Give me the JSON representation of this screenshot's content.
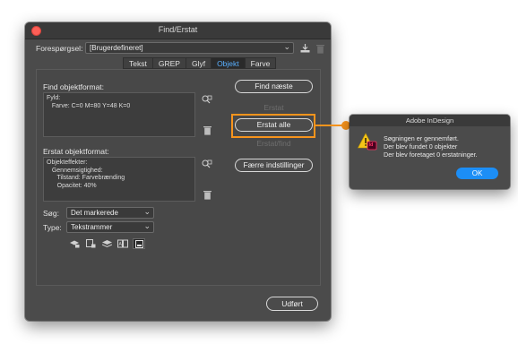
{
  "dialog": {
    "title": "Find/Erstat",
    "query_label": "Forespørgsel:",
    "query_value": "[Brugerdefineret]",
    "tabs": [
      {
        "label": "Tekst"
      },
      {
        "label": "GREP"
      },
      {
        "label": "Glyf"
      },
      {
        "label": "Objekt",
        "active": true
      },
      {
        "label": "Farve"
      }
    ],
    "find_section": {
      "title": "Find objektformat:",
      "lines": [
        "Fyld:",
        "   Farve: C=0 M=80 Y=48 K=0"
      ]
    },
    "replace_section": {
      "title": "Erstat objektformat:",
      "lines": [
        "Objekteffekter:",
        "   Gennemsigtighed:",
        "      Tilstand: Farvebrænding",
        "      Opacitet: 40%"
      ]
    },
    "search_label": "Søg:",
    "search_value": "Det markerede",
    "type_label": "Type:",
    "type_value": "Tekstrammer",
    "buttons": {
      "find_next": "Find næste",
      "replace": "Erstat",
      "replace_all": "Erstat alle",
      "replace_find": "Erstat/find",
      "fewer_options": "Færre indstillinger",
      "done": "Udført"
    },
    "icons": [
      "save-query-icon",
      "trash-icon",
      "specify-format-icon",
      "clear-format-icon",
      "locked-layers-icon",
      "locked-items-icon",
      "hidden-layers-icon",
      "master-pages-icon",
      "footnotes-icon"
    ]
  },
  "alert": {
    "title": "Adobe InDesign",
    "lines": [
      "Søgningen er gennemført.",
      "Der blev fundet 0 objekter",
      "Der blev foretaget 0 erstatninger."
    ],
    "ok_label": "OK",
    "app_badge": "Id"
  },
  "colors": {
    "highlight": "#f7941d",
    "ok_button": "#1c8ef6",
    "active_tab_text": "#5ab0ff"
  }
}
